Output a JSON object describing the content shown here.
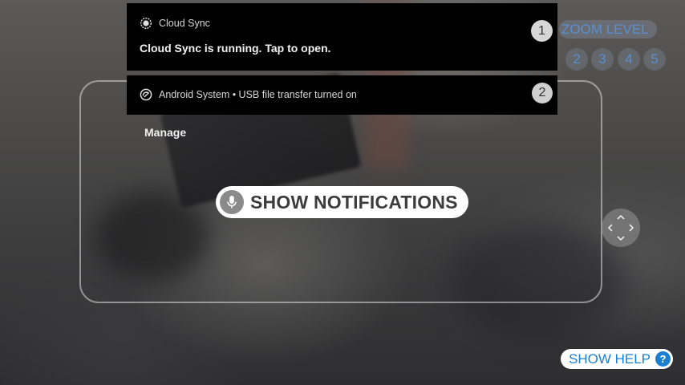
{
  "notifications": [
    {
      "app_name": "Cloud Sync",
      "icon": "cloud-sync-icon",
      "body": "Cloud Sync is running. Tap to open.",
      "badge": "1"
    },
    {
      "app_name": "Android System • USB file transfer turned on",
      "icon": "android-system-icon",
      "badge": "2",
      "action": "Manage"
    }
  ],
  "zoom": {
    "label": "ZOOM LEVEL",
    "levels": [
      "2",
      "3",
      "4",
      "5"
    ]
  },
  "show_notifications": {
    "label": "SHOW NOTIFICATIONS",
    "icon": "microphone-icon"
  },
  "pan_control": {
    "icon": "pan-arrows-icon"
  },
  "show_help": {
    "label": "SHOW HELP",
    "icon_glyph": "?"
  },
  "colors": {
    "accent_blue": "#1b7fd1",
    "zoom_blue": "#5b8fd0",
    "notification_bg": "#000000"
  }
}
